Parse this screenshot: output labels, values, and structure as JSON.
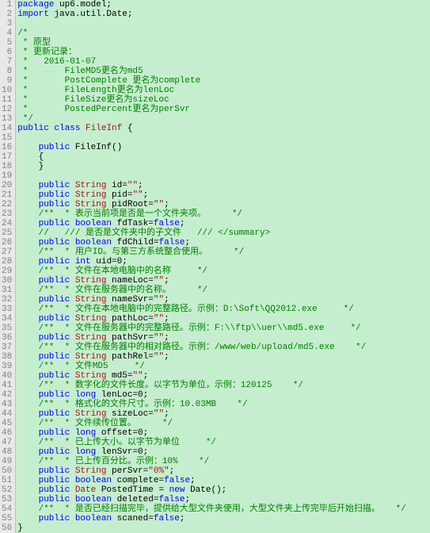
{
  "lines": [
    {
      "n": 1,
      "parts": [
        {
          "c": "kw",
          "t": "package"
        },
        {
          "c": "blk",
          "t": " up6.model;"
        }
      ]
    },
    {
      "n": 2,
      "parts": [
        {
          "c": "kw",
          "t": "import"
        },
        {
          "c": "blk",
          "t": " java.util.Date;"
        }
      ]
    },
    {
      "n": 3,
      "parts": []
    },
    {
      "n": 4,
      "parts": [
        {
          "c": "cmt",
          "t": "/*"
        }
      ],
      "fold": true
    },
    {
      "n": 5,
      "parts": [
        {
          "c": "cmt",
          "t": " * 原型"
        }
      ]
    },
    {
      "n": 6,
      "parts": [
        {
          "c": "cmt",
          "t": " * 更新记录："
        }
      ]
    },
    {
      "n": 7,
      "parts": [
        {
          "c": "cmt",
          "t": " *   2016-01-07"
        }
      ]
    },
    {
      "n": 8,
      "parts": [
        {
          "c": "cmt",
          "t": " *       FileMD5更名为md5"
        }
      ]
    },
    {
      "n": 9,
      "parts": [
        {
          "c": "cmt",
          "t": " *       PostComplete 更名为complete"
        }
      ]
    },
    {
      "n": 10,
      "parts": [
        {
          "c": "cmt",
          "t": " *       FileLength更名为lenLoc"
        }
      ]
    },
    {
      "n": 11,
      "parts": [
        {
          "c": "cmt",
          "t": " *       FileSize更名为sizeLoc"
        }
      ]
    },
    {
      "n": 12,
      "parts": [
        {
          "c": "cmt",
          "t": " *       PostedPercent更名为perSvr"
        }
      ]
    },
    {
      "n": 13,
      "parts": [
        {
          "c": "cmt",
          "t": " */"
        }
      ]
    },
    {
      "n": 14,
      "parts": [
        {
          "c": "kw",
          "t": "public"
        },
        {
          "c": "blk",
          "t": " "
        },
        {
          "c": "kw",
          "t": "class"
        },
        {
          "c": "blk",
          "t": " "
        },
        {
          "c": "cls",
          "t": "FileInf"
        },
        {
          "c": "blk",
          "t": " {"
        }
      ]
    },
    {
      "n": 15,
      "parts": []
    },
    {
      "n": 16,
      "parts": [
        {
          "c": "blk",
          "t": "    "
        },
        {
          "c": "kw",
          "t": "public"
        },
        {
          "c": "blk",
          "t": " FileInf()"
        }
      ],
      "fold": true
    },
    {
      "n": 17,
      "parts": [
        {
          "c": "blk",
          "t": "    {"
        }
      ]
    },
    {
      "n": 18,
      "parts": [
        {
          "c": "blk",
          "t": "    }"
        }
      ]
    },
    {
      "n": 19,
      "parts": []
    },
    {
      "n": 20,
      "parts": [
        {
          "c": "blk",
          "t": "    "
        },
        {
          "c": "kw",
          "t": "public"
        },
        {
          "c": "blk",
          "t": " "
        },
        {
          "c": "cls",
          "t": "String"
        },
        {
          "c": "blk",
          "t": " id="
        },
        {
          "c": "str",
          "t": "\"\""
        },
        {
          "c": "blk",
          "t": ";"
        }
      ]
    },
    {
      "n": 21,
      "parts": [
        {
          "c": "blk",
          "t": "    "
        },
        {
          "c": "kw",
          "t": "public"
        },
        {
          "c": "blk",
          "t": " "
        },
        {
          "c": "cls",
          "t": "String"
        },
        {
          "c": "blk",
          "t": " pid="
        },
        {
          "c": "str",
          "t": "\"\""
        },
        {
          "c": "blk",
          "t": ";"
        }
      ]
    },
    {
      "n": 22,
      "parts": [
        {
          "c": "blk",
          "t": "    "
        },
        {
          "c": "kw",
          "t": "public"
        },
        {
          "c": "blk",
          "t": " "
        },
        {
          "c": "cls",
          "t": "String"
        },
        {
          "c": "blk",
          "t": " pidRoot="
        },
        {
          "c": "str",
          "t": "\"\""
        },
        {
          "c": "blk",
          "t": ";"
        }
      ]
    },
    {
      "n": 23,
      "parts": [
        {
          "c": "blk",
          "t": "    "
        },
        {
          "c": "cmt",
          "t": "/**  * 表示当前项是否是一个文件夹项。     */"
        }
      ]
    },
    {
      "n": 24,
      "parts": [
        {
          "c": "blk",
          "t": "    "
        },
        {
          "c": "kw",
          "t": "public"
        },
        {
          "c": "blk",
          "t": " "
        },
        {
          "c": "kw",
          "t": "boolean"
        },
        {
          "c": "blk",
          "t": " fdTask="
        },
        {
          "c": "kw",
          "t": "false"
        },
        {
          "c": "blk",
          "t": ";"
        }
      ]
    },
    {
      "n": 25,
      "parts": [
        {
          "c": "blk",
          "t": "    "
        },
        {
          "c": "cmt",
          "t": "//   /// 是否是文件夹中的子文件   /// </summary>"
        }
      ]
    },
    {
      "n": 26,
      "parts": [
        {
          "c": "blk",
          "t": "    "
        },
        {
          "c": "kw",
          "t": "public"
        },
        {
          "c": "blk",
          "t": " "
        },
        {
          "c": "kw",
          "t": "boolean"
        },
        {
          "c": "blk",
          "t": " fdChild="
        },
        {
          "c": "kw",
          "t": "false"
        },
        {
          "c": "blk",
          "t": ";"
        }
      ]
    },
    {
      "n": 27,
      "parts": [
        {
          "c": "blk",
          "t": "    "
        },
        {
          "c": "cmt",
          "t": "/**  * 用户ID。与第三方系统整合使用。     */"
        }
      ]
    },
    {
      "n": 28,
      "parts": [
        {
          "c": "blk",
          "t": "    "
        },
        {
          "c": "kw",
          "t": "public"
        },
        {
          "c": "blk",
          "t": " "
        },
        {
          "c": "kw",
          "t": "int"
        },
        {
          "c": "blk",
          "t": " uid=0;"
        }
      ]
    },
    {
      "n": 29,
      "parts": [
        {
          "c": "blk",
          "t": "    "
        },
        {
          "c": "cmt",
          "t": "/**  * 文件在本地电脑中的名称     */"
        }
      ]
    },
    {
      "n": 30,
      "parts": [
        {
          "c": "blk",
          "t": "    "
        },
        {
          "c": "kw",
          "t": "public"
        },
        {
          "c": "blk",
          "t": " "
        },
        {
          "c": "cls",
          "t": "String"
        },
        {
          "c": "blk",
          "t": " nameLoc="
        },
        {
          "c": "str",
          "t": "\"\""
        },
        {
          "c": "blk",
          "t": ";"
        }
      ]
    },
    {
      "n": 31,
      "parts": [
        {
          "c": "blk",
          "t": "    "
        },
        {
          "c": "cmt",
          "t": "/**  * 文件在服务器中的名称。     */"
        }
      ]
    },
    {
      "n": 32,
      "parts": [
        {
          "c": "blk",
          "t": "    "
        },
        {
          "c": "kw",
          "t": "public"
        },
        {
          "c": "blk",
          "t": " "
        },
        {
          "c": "cls",
          "t": "String"
        },
        {
          "c": "blk",
          "t": " nameSvr="
        },
        {
          "c": "str",
          "t": "\"\""
        },
        {
          "c": "blk",
          "t": ";"
        }
      ]
    },
    {
      "n": 33,
      "parts": [
        {
          "c": "blk",
          "t": "    "
        },
        {
          "c": "cmt",
          "t": "/**  * 文件在本地电脑中的完整路径。示例：D:\\Soft\\QQ2012.exe     */"
        }
      ]
    },
    {
      "n": 34,
      "parts": [
        {
          "c": "blk",
          "t": "    "
        },
        {
          "c": "kw",
          "t": "public"
        },
        {
          "c": "blk",
          "t": " "
        },
        {
          "c": "cls",
          "t": "String"
        },
        {
          "c": "blk",
          "t": " pathLoc="
        },
        {
          "c": "str",
          "t": "\"\""
        },
        {
          "c": "blk",
          "t": ";"
        }
      ]
    },
    {
      "n": 35,
      "parts": [
        {
          "c": "blk",
          "t": "    "
        },
        {
          "c": "cmt",
          "t": "/**  * 文件在服务器中的完整路径。示例：F:\\\\ftp\\\\uer\\\\md5.exe     */"
        }
      ]
    },
    {
      "n": 36,
      "parts": [
        {
          "c": "blk",
          "t": "    "
        },
        {
          "c": "kw",
          "t": "public"
        },
        {
          "c": "blk",
          "t": " "
        },
        {
          "c": "cls",
          "t": "String"
        },
        {
          "c": "blk",
          "t": " pathSvr="
        },
        {
          "c": "str",
          "t": "\"\""
        },
        {
          "c": "blk",
          "t": ";"
        }
      ]
    },
    {
      "n": 37,
      "parts": [
        {
          "c": "blk",
          "t": "    "
        },
        {
          "c": "cmt",
          "t": "/**  * 文件在服务器中的相对路径。示例：/www/web/upload/md5.exe    */"
        }
      ]
    },
    {
      "n": 38,
      "parts": [
        {
          "c": "blk",
          "t": "    "
        },
        {
          "c": "kw",
          "t": "public"
        },
        {
          "c": "blk",
          "t": " "
        },
        {
          "c": "cls",
          "t": "String"
        },
        {
          "c": "blk",
          "t": " pathRel="
        },
        {
          "c": "str",
          "t": "\"\""
        },
        {
          "c": "blk",
          "t": ";"
        }
      ]
    },
    {
      "n": 39,
      "parts": [
        {
          "c": "blk",
          "t": "    "
        },
        {
          "c": "cmt",
          "t": "/**  * 文件MD5     */"
        }
      ]
    },
    {
      "n": 40,
      "parts": [
        {
          "c": "blk",
          "t": "    "
        },
        {
          "c": "kw",
          "t": "public"
        },
        {
          "c": "blk",
          "t": " "
        },
        {
          "c": "cls",
          "t": "String"
        },
        {
          "c": "blk",
          "t": " md5="
        },
        {
          "c": "str",
          "t": "\"\""
        },
        {
          "c": "blk",
          "t": ";"
        }
      ]
    },
    {
      "n": 41,
      "parts": [
        {
          "c": "blk",
          "t": "    "
        },
        {
          "c": "cmt",
          "t": "/**  * 数字化的文件长度。以字节为单位，示例：120125    */"
        }
      ]
    },
    {
      "n": 42,
      "parts": [
        {
          "c": "blk",
          "t": "    "
        },
        {
          "c": "kw",
          "t": "public"
        },
        {
          "c": "blk",
          "t": " "
        },
        {
          "c": "kw",
          "t": "long"
        },
        {
          "c": "blk",
          "t": " lenLoc=0;"
        }
      ]
    },
    {
      "n": 43,
      "parts": [
        {
          "c": "blk",
          "t": "    "
        },
        {
          "c": "cmt",
          "t": "/**  * 格式化的文件尺寸。示例：10.03MB    */"
        }
      ]
    },
    {
      "n": 44,
      "parts": [
        {
          "c": "blk",
          "t": "    "
        },
        {
          "c": "kw",
          "t": "public"
        },
        {
          "c": "blk",
          "t": " "
        },
        {
          "c": "cls",
          "t": "String"
        },
        {
          "c": "blk",
          "t": " sizeLoc="
        },
        {
          "c": "str",
          "t": "\"\""
        },
        {
          "c": "blk",
          "t": ";"
        }
      ]
    },
    {
      "n": 45,
      "parts": [
        {
          "c": "blk",
          "t": "    "
        },
        {
          "c": "cmt",
          "t": "/**  * 文件续传位置。     */"
        }
      ]
    },
    {
      "n": 46,
      "parts": [
        {
          "c": "blk",
          "t": "    "
        },
        {
          "c": "kw",
          "t": "public"
        },
        {
          "c": "blk",
          "t": " "
        },
        {
          "c": "kw",
          "t": "long"
        },
        {
          "c": "blk",
          "t": " offset=0;"
        }
      ]
    },
    {
      "n": 47,
      "parts": [
        {
          "c": "blk",
          "t": "    "
        },
        {
          "c": "cmt",
          "t": "/**  * 已上传大小。以字节为单位     */"
        }
      ]
    },
    {
      "n": 48,
      "parts": [
        {
          "c": "blk",
          "t": "    "
        },
        {
          "c": "kw",
          "t": "public"
        },
        {
          "c": "blk",
          "t": " "
        },
        {
          "c": "kw",
          "t": "long"
        },
        {
          "c": "blk",
          "t": " lenSvr=0;"
        }
      ]
    },
    {
      "n": 49,
      "parts": [
        {
          "c": "blk",
          "t": "    "
        },
        {
          "c": "cmt",
          "t": "/**  * 已上传百分比。示例：10%    */"
        }
      ]
    },
    {
      "n": 50,
      "parts": [
        {
          "c": "blk",
          "t": "    "
        },
        {
          "c": "kw",
          "t": "public"
        },
        {
          "c": "blk",
          "t": " "
        },
        {
          "c": "cls",
          "t": "String"
        },
        {
          "c": "blk",
          "t": " perSvr="
        },
        {
          "c": "str",
          "t": "\"0%\""
        },
        {
          "c": "blk",
          "t": ";"
        }
      ]
    },
    {
      "n": 51,
      "parts": [
        {
          "c": "blk",
          "t": "    "
        },
        {
          "c": "kw",
          "t": "public"
        },
        {
          "c": "blk",
          "t": " "
        },
        {
          "c": "kw",
          "t": "boolean"
        },
        {
          "c": "blk",
          "t": " complete="
        },
        {
          "c": "kw",
          "t": "false"
        },
        {
          "c": "blk",
          "t": ";"
        }
      ]
    },
    {
      "n": 52,
      "parts": [
        {
          "c": "blk",
          "t": "    "
        },
        {
          "c": "kw",
          "t": "public"
        },
        {
          "c": "blk",
          "t": " "
        },
        {
          "c": "cls",
          "t": "Date"
        },
        {
          "c": "blk",
          "t": " PostedTime = "
        },
        {
          "c": "kw",
          "t": "new"
        },
        {
          "c": "blk",
          "t": " Date();"
        }
      ]
    },
    {
      "n": 53,
      "parts": [
        {
          "c": "blk",
          "t": "    "
        },
        {
          "c": "kw",
          "t": "public"
        },
        {
          "c": "blk",
          "t": " "
        },
        {
          "c": "kw",
          "t": "boolean"
        },
        {
          "c": "blk",
          "t": " deleted="
        },
        {
          "c": "kw",
          "t": "false"
        },
        {
          "c": "blk",
          "t": ";"
        }
      ]
    },
    {
      "n": 54,
      "parts": [
        {
          "c": "blk",
          "t": "    "
        },
        {
          "c": "cmt",
          "t": "/**  * 是否已经扫描完毕，提供给大型文件夹使用，大型文件夹上传完毕后开始扫描。   */"
        }
      ]
    },
    {
      "n": 55,
      "parts": [
        {
          "c": "blk",
          "t": "    "
        },
        {
          "c": "kw",
          "t": "public"
        },
        {
          "c": "blk",
          "t": " "
        },
        {
          "c": "kw",
          "t": "boolean"
        },
        {
          "c": "blk",
          "t": " scaned="
        },
        {
          "c": "kw",
          "t": "false"
        },
        {
          "c": "blk",
          "t": ";"
        }
      ]
    },
    {
      "n": 56,
      "parts": [
        {
          "c": "blk",
          "t": "}"
        }
      ]
    }
  ]
}
